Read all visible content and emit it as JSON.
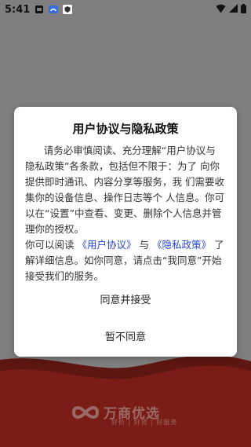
{
  "status_bar": {
    "time": "5:41",
    "icons": [
      "app-notification-icon",
      "chat-icon",
      "shield-icon",
      "wifi-icon",
      "signal-icon",
      "battery-icon"
    ]
  },
  "dialog": {
    "title": "用户协议与隐私政策",
    "paragraph1": "请务必审慎阅读、充分理解“用户协议与 隐私政策”各条款，包括但不限于：为了 向你提供即时通讯、内容分享等服务，我 们需要收集你的设备信息、操作日志等个 人信息。你可以在“设置”中查看、变更、删除个人信息并管理你的授权。",
    "p2_prefix": "你可以阅读",
    "user_agreement_link": "《用户协议》",
    "p2_and": "与",
    "privacy_link": "《隐私政策》",
    "p2_suffix": "了解详细信息。如你同意，请点击“我同意”开始接受我们的服务。",
    "agree_button": "同意并接受",
    "disagree_button": "暂不同意"
  },
  "background": {
    "brand_name": "万商优选",
    "brand_tagline": "好价 | 好货 | 好服务",
    "colors": {
      "dim": "#7f7f7f",
      "brand_red": "#7a1d16",
      "link": "#2646d6"
    }
  }
}
